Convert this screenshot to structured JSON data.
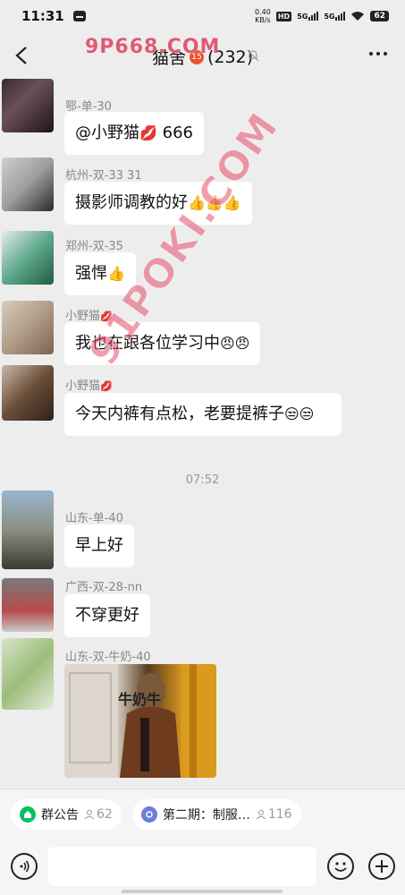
{
  "status_bar": {
    "time": "11:31",
    "net_speed_value": "0.40",
    "net_speed_unit": "KB/s",
    "hd_label": "HD",
    "sig1_label": "5G",
    "sig2_label": "5G",
    "battery": "62"
  },
  "header": {
    "title": "猫舍",
    "title_badge": "15",
    "member_count": "(232)",
    "watermark": "9P668.COM"
  },
  "watermark_diagonal": "91POKI.COM",
  "messages": [
    {
      "sender": "鄂-单-30",
      "text": "@小野猫",
      "emoji": "💋",
      "suffix": " 666"
    },
    {
      "sender": "杭州-双-33  31",
      "text": "摄影师调教的好",
      "emoji": "👍👍👍",
      "suffix": ""
    },
    {
      "sender": "郑州-双-35",
      "text": "强悍",
      "emoji": "👍",
      "suffix": ""
    },
    {
      "sender": "小野猫",
      "sender_emoji": "💋",
      "text": "我也在跟各位学习中",
      "emoji": "😠😠",
      "suffix": ""
    },
    {
      "sender": "小野猫",
      "sender_emoji": "💋",
      "text": "今天内裤有点松，老要提裤子",
      "emoji": "😒😒",
      "suffix": ""
    },
    {
      "sender": "山东-单-40",
      "text": "早上好",
      "emoji": "",
      "suffix": ""
    },
    {
      "sender": "广西-双-28-nn",
      "text": "不穿更好",
      "emoji": "",
      "suffix": ""
    },
    {
      "sender": "山东-双-牛奶-40",
      "image": true,
      "image_caption": "牛奶牛"
    }
  ],
  "time_separator": "07:52",
  "pinned": {
    "notice_label": "群公告",
    "notice_count": "62",
    "second_label": "第二期：制服…",
    "second_count": "116"
  },
  "colors": {
    "background": "#ededed",
    "bubble": "#ffffff",
    "watermark": "#e04e6c",
    "notice_dot": "#07c160",
    "second_dot": "#6b7fd8"
  }
}
